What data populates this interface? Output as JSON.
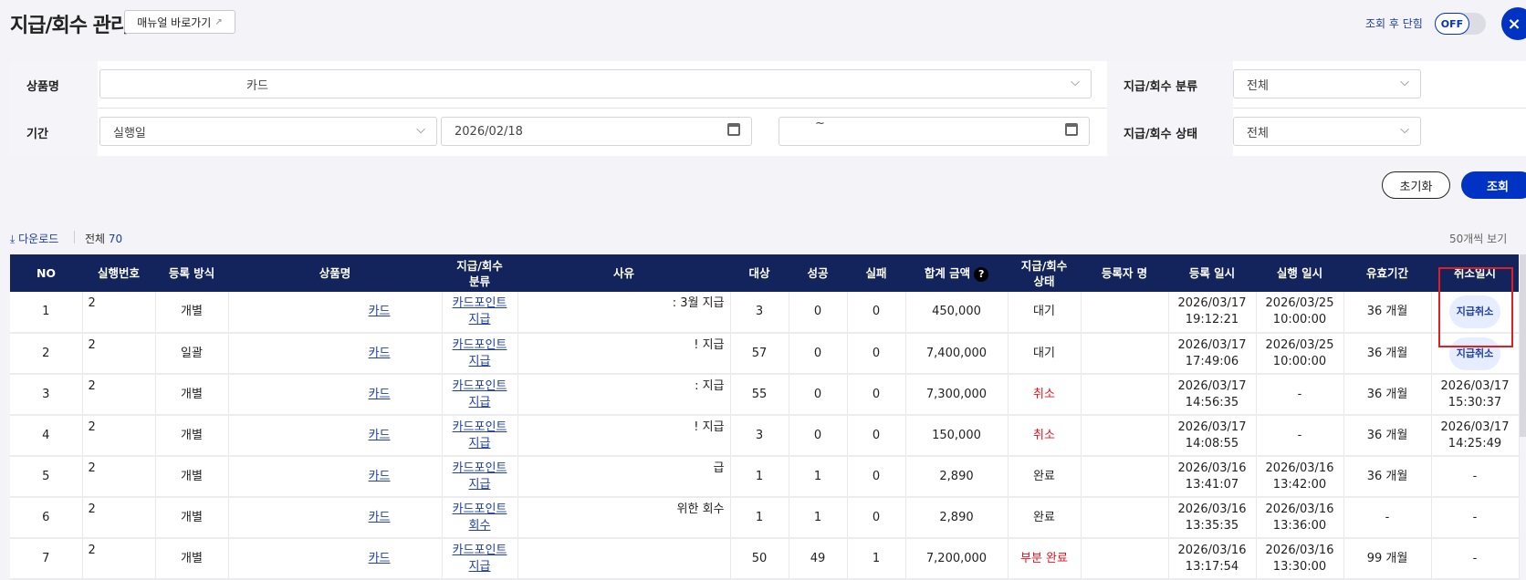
{
  "header": {
    "title": "지급/회수 관리",
    "manual_label": "매뉴얼 바로가기",
    "toggle_label": "조회 후 단힘",
    "toggle_state": "OFF",
    "close_icon": "×"
  },
  "filters": {
    "product_label": "상품명",
    "product_value": "카드",
    "category_label": "지급/회수 분류",
    "category_value": "전체",
    "period_label": "기간",
    "period_type": "실행일",
    "date_from": "2026/02/18",
    "date_to": "",
    "tilde": "~",
    "status_label": "지급/회수 상태",
    "status_value": "전체"
  },
  "actions": {
    "reset": "초기화",
    "search": "조회"
  },
  "list": {
    "download": "다운로드",
    "total_label": "전체",
    "total_count": "70",
    "per_page": "50개씩 보기"
  },
  "table": {
    "columns": [
      "NO",
      "실행번호",
      "등록 방식",
      "상품명",
      "지급/회수\n분류",
      "사유",
      "대상",
      "성공",
      "실패",
      "합계 금액",
      "지급/회수\n상태",
      "등록자 명",
      "등록 일시",
      "실행 일시",
      "유효기간",
      "취소일시"
    ],
    "rows": [
      {
        "no": "1",
        "exec": "2",
        "method": "개별",
        "product": "카드",
        "category": "카드포인트\n지급",
        "reason": ": 3월 지급",
        "target": "3",
        "success": "0",
        "fail": "0",
        "amount": "450,000",
        "status": "대기",
        "registrant": "",
        "reg": "2026/03/17\n19:12:21",
        "run": "2026/03/25\n10:00:00",
        "valid": "36 개월",
        "cancel": "지급취소",
        "cancel_is_button": true
      },
      {
        "no": "2",
        "exec": "2",
        "method": "일괄",
        "product": "카드",
        "category": "카드포인트\n지급",
        "reason": "! 지급",
        "target": "57",
        "success": "0",
        "fail": "0",
        "amount": "7,400,000",
        "status": "대기",
        "registrant": "",
        "reg": "2026/03/17\n17:49:06",
        "run": "2026/03/25\n10:00:00",
        "valid": "36 개월",
        "cancel": "지급취소",
        "cancel_is_button": true
      },
      {
        "no": "3",
        "exec": "2",
        "method": "개별",
        "product": "카드",
        "category": "카드포인트\n지급",
        "reason": ": 지급",
        "target": "55",
        "success": "0",
        "fail": "0",
        "amount": "7,300,000",
        "status": "취소",
        "registrant": "",
        "reg": "2026/03/17\n14:56:35",
        "run": "-",
        "valid": "36 개월",
        "cancel": "2026/03/17\n15:30:37"
      },
      {
        "no": "4",
        "exec": "2",
        "method": "개별",
        "product": "카드",
        "category": "카드포인트\n지급",
        "reason": "! 지급",
        "target": "3",
        "success": "0",
        "fail": "0",
        "amount": "150,000",
        "status": "취소",
        "registrant": "",
        "reg": "2026/03/17\n14:08:55",
        "run": "-",
        "valid": "36 개월",
        "cancel": "2026/03/17\n14:25:49"
      },
      {
        "no": "5",
        "exec": "2",
        "method": "개별",
        "product": "카드",
        "category": "카드포인트\n지급",
        "reason": "급",
        "target": "1",
        "success": "1",
        "fail": "0",
        "amount": "2,890",
        "status": "완료",
        "registrant": "",
        "reg": "2026/03/16\n13:41:07",
        "run": "2026/03/16\n13:42:00",
        "valid": "36 개월",
        "cancel": "-"
      },
      {
        "no": "6",
        "exec": "2",
        "method": "개별",
        "product": "카드",
        "category": "카드포인트\n회수",
        "reason": "위한 회수",
        "target": "1",
        "success": "1",
        "fail": "0",
        "amount": "2,890",
        "status": "완료",
        "registrant": "",
        "reg": "2026/03/16\n13:35:35",
        "run": "2026/03/16\n13:36:00",
        "valid": "-",
        "cancel": "-"
      },
      {
        "no": "7",
        "exec": "2",
        "method": "개별",
        "product": "카드",
        "category": "카드포인트\n지급",
        "reason": "",
        "target": "50",
        "success": "49",
        "fail": "1",
        "amount": "7,200,000",
        "status": "부분 완료",
        "registrant": "",
        "reg": "2026/03/16\n13:17:54",
        "run": "2026/03/16\n13:30:00",
        "valid": "99 개월",
        "cancel": "-"
      }
    ]
  },
  "colors": {
    "navy": "#13235b",
    "primary": "#0033c4",
    "link": "#1e3ea8",
    "danger": "#e0141e"
  }
}
